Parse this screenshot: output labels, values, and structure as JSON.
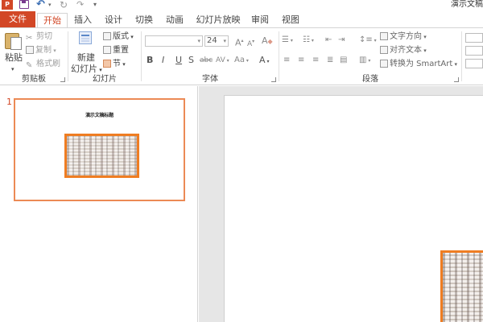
{
  "window": {
    "title": "演示文稿"
  },
  "quick_access": {
    "icons": [
      "powerpoint-icon",
      "save-icon",
      "undo-icon",
      "redo-icon",
      "repeat-icon"
    ],
    "app_badge": "P"
  },
  "tabs": [
    {
      "label": "文件"
    },
    {
      "label": "开始"
    },
    {
      "label": "插入"
    },
    {
      "label": "设计"
    },
    {
      "label": "切换"
    },
    {
      "label": "动画"
    },
    {
      "label": "幻灯片放映"
    },
    {
      "label": "审阅"
    },
    {
      "label": "视图"
    }
  ],
  "ribbon": {
    "clipboard": {
      "label": "剪贴板",
      "paste": "粘贴",
      "cut": "剪切",
      "copy": "复制",
      "format_painter": "格式刷"
    },
    "slides": {
      "label": "幻灯片",
      "new_slide_line1": "新建",
      "new_slide_line2": "幻灯片",
      "layout": "版式",
      "reset": "重置",
      "section": "节"
    },
    "font": {
      "label": "字体",
      "font_name": "",
      "font_size": "24",
      "grow": "A",
      "shrink": "A",
      "clear": "A",
      "bold": "B",
      "italic": "I",
      "underline": "U",
      "shadow": "S",
      "strike": "abc",
      "spacing": "AV",
      "case": "Aa",
      "color": "A"
    },
    "paragraph": {
      "label": "段落",
      "text_direction": "文字方向",
      "align_text": "对齐文本",
      "convert_smartart": "转换为 SmartArt"
    }
  },
  "thumbnails": [
    {
      "number": "1",
      "title": "演示文稿标题"
    }
  ],
  "colors": {
    "accent": "#d24726",
    "image_border": "#ef7d22",
    "thumb_border": "#ec8a55"
  }
}
